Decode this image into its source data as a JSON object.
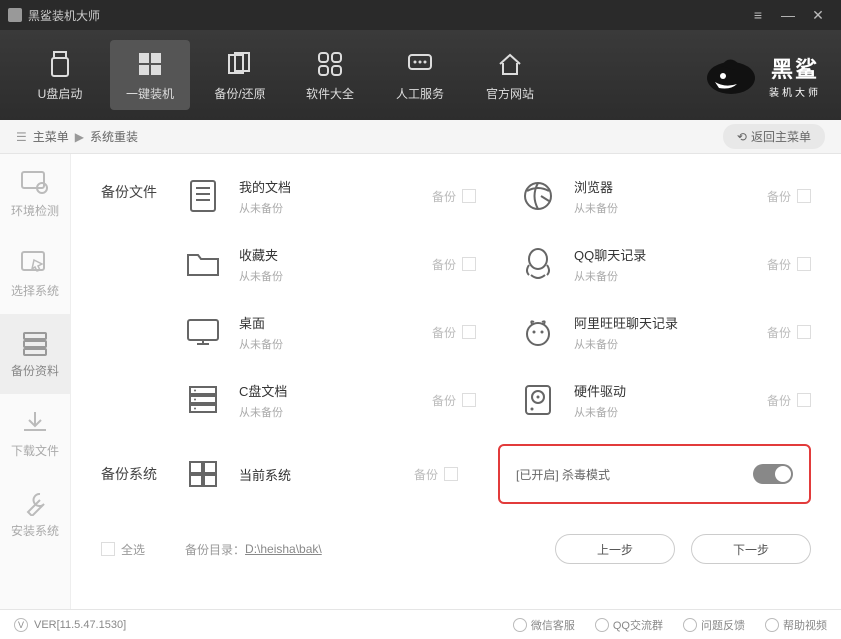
{
  "window": {
    "title": "黑鲨装机大师"
  },
  "topnav": {
    "items": [
      {
        "label": "U盘启动"
      },
      {
        "label": "一键装机"
      },
      {
        "label": "备份/还原"
      },
      {
        "label": "软件大全"
      },
      {
        "label": "人工服务"
      },
      {
        "label": "官方网站"
      }
    ],
    "brand": {
      "line1": "黑鲨",
      "line2": "装机大师"
    }
  },
  "breadcrumb": {
    "root": "主菜单",
    "current": "系统重装",
    "back": "返回主菜单"
  },
  "sidebar": {
    "items": [
      {
        "label": "环境检测"
      },
      {
        "label": "选择系统"
      },
      {
        "label": "备份资料"
      },
      {
        "label": "下载文件"
      },
      {
        "label": "安装系统"
      }
    ]
  },
  "content": {
    "section_files": "备份文件",
    "section_system": "备份系统",
    "backup_label": "备份",
    "never_backup": "从未备份",
    "items": [
      {
        "title": "我的文档"
      },
      {
        "title": "浏览器"
      },
      {
        "title": "收藏夹"
      },
      {
        "title": "QQ聊天记录"
      },
      {
        "title": "桌面"
      },
      {
        "title": "阿里旺旺聊天记录"
      },
      {
        "title": "C盘文档"
      },
      {
        "title": "硬件驱动"
      }
    ],
    "current_system": "当前系统",
    "antivirus": {
      "text": "[已开启] 杀毒模式"
    },
    "select_all": "全选",
    "dir_label": "备份目录：",
    "dir_path": "D:\\heisha\\bak\\",
    "prev": "上一步",
    "next": "下一步"
  },
  "statusbar": {
    "version": "VER[11.5.47.1530]",
    "items": [
      {
        "label": "微信客服"
      },
      {
        "label": "QQ交流群"
      },
      {
        "label": "问题反馈"
      },
      {
        "label": "帮助视频"
      }
    ]
  }
}
